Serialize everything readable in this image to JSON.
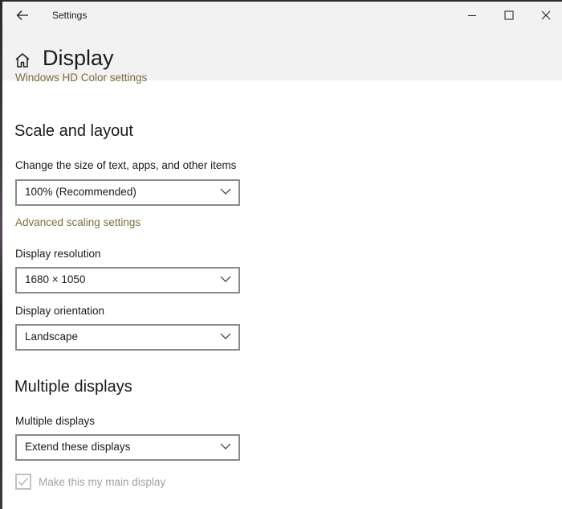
{
  "titlebar": {
    "title": "Settings",
    "back_icon": "back-arrow-icon",
    "minimize_icon": "minimize-icon",
    "maximize_icon": "maximize-icon",
    "close_icon": "close-icon"
  },
  "header": {
    "home_icon": "home-icon",
    "page_title": "Display"
  },
  "content": {
    "hd_color_link": "Windows HD Color settings",
    "scale_section": {
      "title": "Scale and layout",
      "size_label": "Change the size of text, apps, and other items",
      "size_value": "100% (Recommended)",
      "advanced_scaling_link": "Advanced scaling settings",
      "resolution_label": "Display resolution",
      "resolution_value": "1680 × 1050",
      "orientation_label": "Display orientation",
      "orientation_value": "Landscape"
    },
    "multiple_section": {
      "title": "Multiple displays",
      "multiple_label": "Multiple displays",
      "multiple_value": "Extend these displays",
      "main_display_checkbox_label": "Make this my main display",
      "main_display_checked": true,
      "main_display_disabled": true
    }
  },
  "colors": {
    "link": "#7a6f3a",
    "titlebar_bg": "#f2f2f2",
    "dropdown_border": "#8a8a8a",
    "disabled_text": "#a3a3a3"
  }
}
